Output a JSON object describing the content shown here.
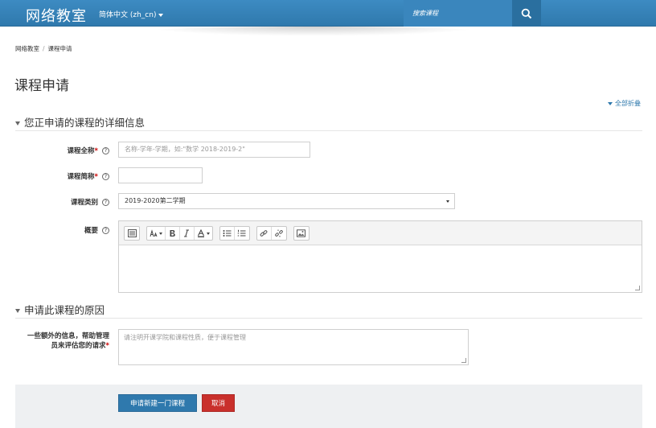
{
  "navbar": {
    "brand": "网络教室",
    "language": "简体中文 (zh_cn)",
    "search_placeholder": "搜索课程"
  },
  "breadcrumb": {
    "items": [
      "网络教室",
      "课程申请"
    ],
    "separator": "/"
  },
  "page_title": "课程申请",
  "collapse_all": "全部折叠",
  "section1": {
    "title": "您正申请的课程的详细信息",
    "fullname_label": "课程全称",
    "fullname_placeholder": "名称-学年-学期，如:\"数学 2018-2019-2\"",
    "shortname_label": "课程简称",
    "category_label": "课程类别",
    "category_value": "2019-2020第二学期",
    "summary_label": "概要"
  },
  "section2": {
    "title": "申请此课程的原因",
    "reason_label_line1": "一些额外的信息，帮助管理",
    "reason_label_line2": "员来评估您的请求",
    "reason_placeholder": "请注明开课学院和课程性质，便于课程管理"
  },
  "buttons": {
    "submit": "申请新建一门课程",
    "cancel": "取消"
  },
  "markers": {
    "required": "*",
    "help": "?"
  },
  "colors": {
    "brand": "#2f79ad",
    "danger": "#c9302c",
    "required": "#cc0000"
  }
}
